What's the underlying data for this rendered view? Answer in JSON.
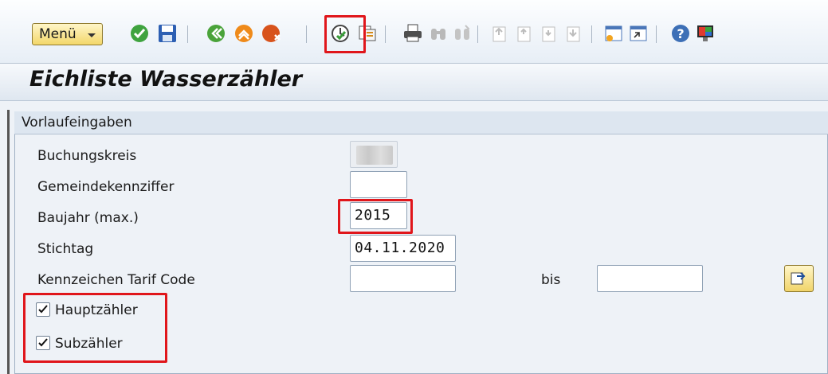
{
  "toolbar": {
    "menu_label": "Menü",
    "icons": [
      "check-icon",
      "save-icon",
      "back-icon",
      "exit-icon",
      "cancel-icon",
      "execute-icon",
      "get-variant-icon",
      "print-icon",
      "find-icon",
      "find-next-icon",
      "first-page-icon",
      "previous-page-icon",
      "next-page-icon",
      "last-page-icon",
      "new-session-icon",
      "create-shortcut-icon",
      "help-icon",
      "customize-layout-icon"
    ]
  },
  "page": {
    "title": "Eichliste Wasserzähler"
  },
  "group": {
    "title": "Vorlaufeingaben",
    "fields": {
      "buchungskreis": {
        "label": "Buchungskreis",
        "value": ""
      },
      "gemeindekennziffer": {
        "label": "Gemeindekennziffer",
        "value": ""
      },
      "baujahr": {
        "label": "Baujahr (max.)",
        "value": "2015"
      },
      "stichtag": {
        "label": "Stichtag",
        "value": "04.11.2020"
      },
      "tarif_code": {
        "label": "Kennzeichen Tarif Code",
        "value": "",
        "to_label": "bis",
        "to_value": ""
      }
    },
    "checkboxes": {
      "hauptzaehler": {
        "label": "Hauptzähler",
        "checked": true
      },
      "subzaehler": {
        "label": "Subzähler",
        "checked": true
      }
    }
  },
  "colors": {
    "highlight": "#e0161b",
    "brand_yellow": "#f3d76a",
    "ok_green": "#3a9d3a"
  }
}
